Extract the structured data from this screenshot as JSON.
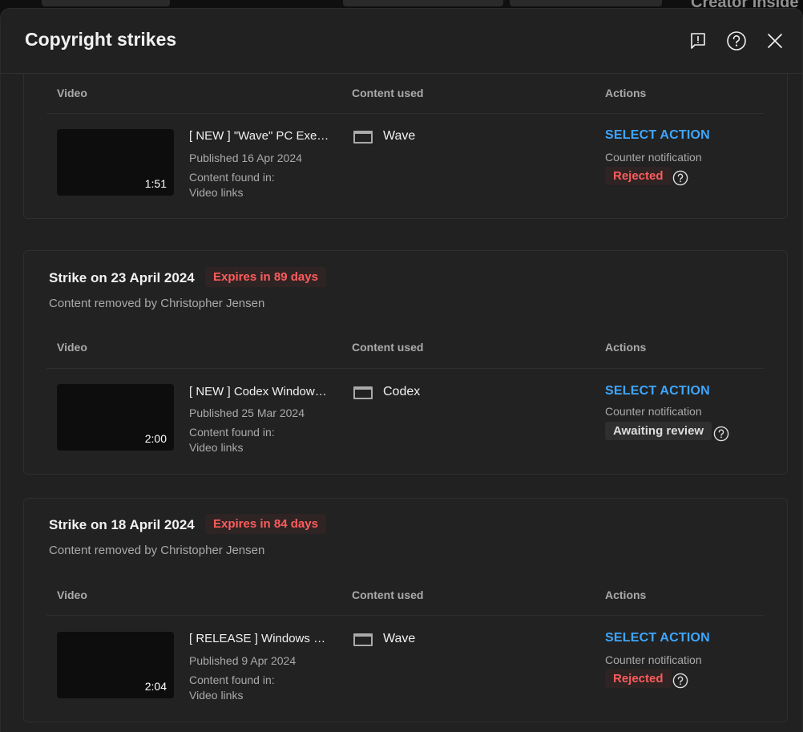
{
  "background": {
    "partial_text": "Creator Inside"
  },
  "dialog": {
    "title": "Copyright strikes",
    "icons": [
      "feedback-icon",
      "help-icon",
      "close-icon"
    ]
  },
  "columns": {
    "video": "Video",
    "content_used": "Content used",
    "actions": "Actions"
  },
  "strikes": [
    {
      "video": {
        "title": "[ NEW ] \"Wave\" PC Executor",
        "duration": "1:51",
        "published": "Published 16 Apr 2024",
        "found_label": "Content found in:",
        "found_in": "Video links"
      },
      "content_used": "Wave",
      "action_label": "SELECT ACTION",
      "counter_label": "Counter notification",
      "status": "Rejected"
    },
    {
      "title": "Strike on 23 April 2024",
      "expires": "Expires in 89 days",
      "removed_by": "Content removed by Christopher Jensen",
      "video": {
        "title": "[ NEW ] Codex Windows Executor",
        "duration": "2:00",
        "published": "Published 25 Mar 2024",
        "found_label": "Content found in:",
        "found_in": "Video links"
      },
      "content_used": "Codex",
      "action_label": "SELECT ACTION",
      "counter_label": "Counter notification",
      "status": "Awaiting review"
    },
    {
      "title": "Strike on 18 April 2024",
      "expires": "Expires in 84 days",
      "removed_by": "Content removed by Christopher Jensen",
      "video": {
        "title": "[ RELEASE ] Windows Executor",
        "duration": "2:04",
        "published": "Published 9 Apr 2024",
        "found_label": "Content found in:",
        "found_in": "Video links"
      },
      "content_used": "Wave",
      "action_label": "SELECT ACTION",
      "counter_label": "Counter notification",
      "status": "Rejected"
    }
  ],
  "colors": {
    "accent": "#3ea6ff",
    "danger": "#ff5c5c",
    "surface": "#212121"
  }
}
